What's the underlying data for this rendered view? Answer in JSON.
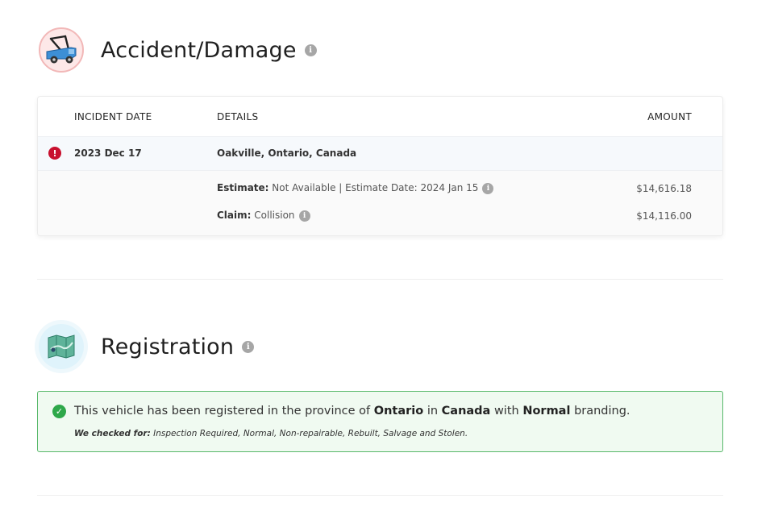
{
  "accident": {
    "title": "Accident/Damage",
    "info_glyph": "i",
    "table": {
      "headers": {
        "date": "INCIDENT DATE",
        "details": "DETAILS",
        "amount": "AMOUNT"
      },
      "incident": {
        "alert_glyph": "!",
        "date": "2023 Dec 17",
        "location": "Oakville, Ontario, Canada",
        "estimate_label": "Estimate:",
        "estimate_value": "Not Available | Estimate Date: 2024 Jan 15",
        "estimate_amount": "$14,616.18",
        "claim_label": "Claim:",
        "claim_value": "Collision",
        "claim_amount": "$14,116.00"
      }
    }
  },
  "registration": {
    "title": "Registration",
    "info_glyph": "i",
    "check_glyph": "✓",
    "message": {
      "prefix": "This vehicle has been registered in the province of",
      "province": "Ontario",
      "in": "in",
      "country": "Canada",
      "with": "with",
      "branding": "Normal",
      "suffix": "branding."
    },
    "checked_label": "We checked for:",
    "checked_list": "Inspection Required, Normal, Non-repairable, Rebuilt, Salvage and Stolen."
  },
  "colors": {
    "alert_red": "#c8102e",
    "success_green": "#2ea84a",
    "success_border": "#58b86a",
    "success_bg": "#f0faf1",
    "info_gray": "#a6a6a6"
  },
  "icons": {
    "accident_emblem": "tow-truck-icon",
    "registration_emblem": "map-icon",
    "info": "info-icon",
    "alert": "exclamation-circle-icon",
    "check": "check-circle-icon"
  }
}
